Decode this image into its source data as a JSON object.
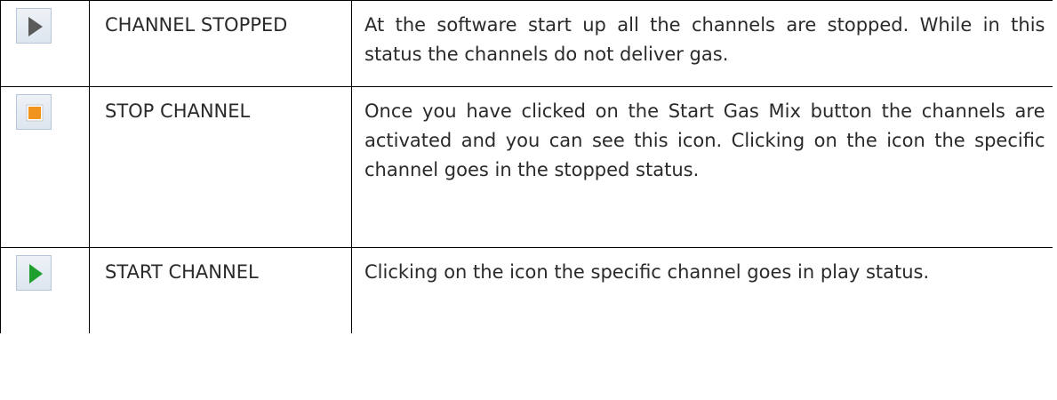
{
  "colors": {
    "stopped_triangle": "#5a5a5a",
    "stop_square": "#f0941e",
    "start_triangle": "#1fa02e"
  },
  "rows": [
    {
      "icon": "play-grey-icon",
      "name": "CHANNEL STOPPED",
      "description": "At the software start up all the channels are stopped. While in this status the channels do not deliver gas."
    },
    {
      "icon": "stop-orange-icon",
      "name": "STOP CHANNEL",
      "description": "Once you have clicked on the Start Gas Mix button the channels are activated and you can see this icon. Clicking on the icon the specific channel goes in the stopped status."
    },
    {
      "icon": "play-green-icon",
      "name": "START CHANNEL",
      "description": "Clicking on the icon the specific channel goes in play status."
    }
  ]
}
